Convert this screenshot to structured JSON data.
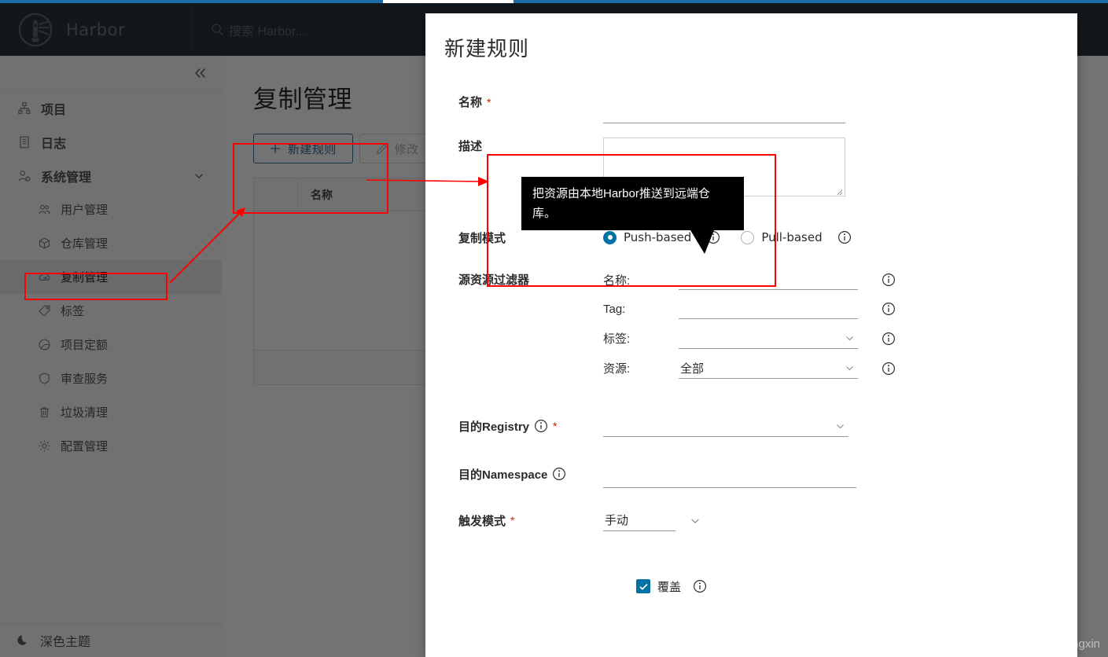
{
  "theme": {
    "accent_blue": "#1b6ca8",
    "header_bg": "#27343c",
    "link_blue": "#3b6e8f",
    "radio_blue": "#0072a3",
    "required_red": "#c92100",
    "annotation_red": "#ff0000"
  },
  "header": {
    "brand": "Harbor",
    "logo_icon": "harbor-lighthouse-logo",
    "search_icon": "search-icon",
    "search_placeholder": "搜索 Harbor..."
  },
  "sidebar": {
    "collapse_icon": "double-chevron-left-icon",
    "items": [
      {
        "label": "项目",
        "icon": "sitemap-icon",
        "level": "top",
        "active": false
      },
      {
        "label": "日志",
        "icon": "list-icon",
        "level": "top",
        "active": false
      },
      {
        "label": "系统管理",
        "icon": "user-cog-icon",
        "level": "top",
        "active": false,
        "expanded": true,
        "caret": "chevron-down-icon"
      },
      {
        "label": "用户管理",
        "icon": "users-icon",
        "level": "sub",
        "active": false
      },
      {
        "label": "仓库管理",
        "icon": "cube-icon",
        "level": "sub",
        "active": false
      },
      {
        "label": "复制管理",
        "icon": "cloud-sync-icon",
        "level": "sub",
        "active": true
      },
      {
        "label": "标签",
        "icon": "tag-icon",
        "level": "sub",
        "active": false
      },
      {
        "label": "项目定额",
        "icon": "pie-chart-icon",
        "level": "sub",
        "active": false
      },
      {
        "label": "审查服务",
        "icon": "shield-icon",
        "level": "sub",
        "active": false
      },
      {
        "label": "垃圾清理",
        "icon": "trash-icon",
        "level": "sub",
        "active": false
      },
      {
        "label": "配置管理",
        "icon": "gear-icon",
        "level": "sub",
        "active": false
      }
    ],
    "theme_toggle": {
      "label": "深色主题",
      "icon": "moon-icon"
    }
  },
  "page": {
    "title": "复制管理",
    "toolbar": {
      "new_rule_label": "新建规则",
      "new_rule_icon": "plus-icon",
      "edit_label": "修改",
      "edit_icon": "pencil-icon",
      "edit_disabled": true
    },
    "table": {
      "columns": [
        "名称"
      ]
    }
  },
  "modal": {
    "title": "新建规则",
    "fields": {
      "name": {
        "label": "名称",
        "required": true,
        "value": "",
        "placeholder": ""
      },
      "description": {
        "label": "描述",
        "value": "",
        "placeholder": ""
      },
      "replication_mode": {
        "label": "复制模式",
        "options": [
          {
            "label": "Push-based",
            "selected": true,
            "info_icon": "info-circle-icon"
          },
          {
            "label": "Pull-based",
            "selected": false,
            "info_icon": "info-circle-icon"
          }
        ]
      },
      "source_filter": {
        "label": "源资源过滤器",
        "rows": [
          {
            "label": "名称:",
            "type": "text",
            "value": "",
            "info_icon": "info-circle-icon"
          },
          {
            "label": "Tag:",
            "type": "text",
            "value": "",
            "info_icon": "info-circle-icon"
          },
          {
            "label": "标签:",
            "type": "select",
            "value": "",
            "info_icon": "info-circle-icon"
          },
          {
            "label": "资源:",
            "type": "select",
            "value": "全部",
            "info_icon": "info-circle-icon"
          }
        ]
      },
      "dest_registry": {
        "label": "目的Registry",
        "required": true,
        "value": "",
        "info_icon": "info-circle-icon"
      },
      "dest_namespace": {
        "label": "目的Namespace",
        "required": false,
        "value": "",
        "info_icon": "info-circle-icon"
      },
      "trigger_mode": {
        "label": "触发模式",
        "required": true,
        "value": "手动",
        "info_icon": ""
      },
      "override": {
        "label": "覆盖",
        "checked": true,
        "info_icon": "info-circle-icon"
      }
    }
  },
  "tooltip": {
    "text": "把资源由本地Harbor推送到远端仓库。"
  },
  "watermark": "https://blog.csdn.net/cuichongxin"
}
